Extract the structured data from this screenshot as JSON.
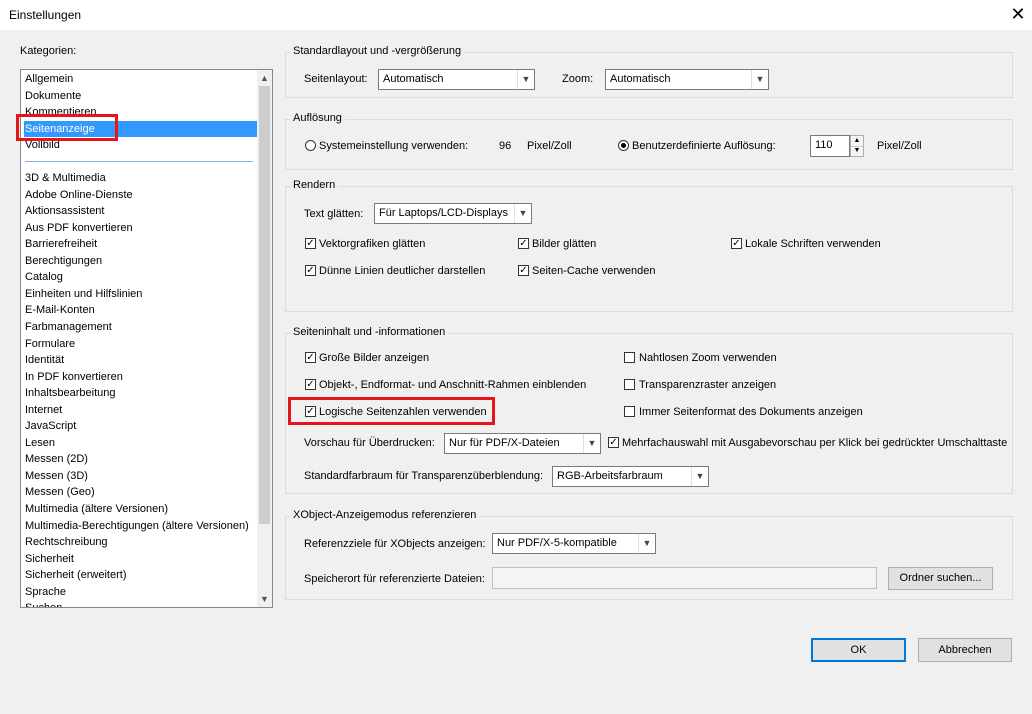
{
  "window": {
    "title": "Einstellungen"
  },
  "categories": {
    "label": "Kategorien:",
    "top_items": [
      "Allgemein",
      "Dokumente",
      "Kommentieren",
      "Seitenanzeige",
      "Vollbild"
    ],
    "items": [
      "3D & Multimedia",
      "Adobe Online-Dienste",
      "Aktionsassistent",
      "Aus PDF konvertieren",
      "Barrierefreiheit",
      "Berechtigungen",
      "Catalog",
      "Einheiten und Hilfslinien",
      "E-Mail-Konten",
      "Farbmanagement",
      "Formulare",
      "Identität",
      "In PDF konvertieren",
      "Inhaltsbearbeitung",
      "Internet",
      "JavaScript",
      "Lesen",
      "Messen (2D)",
      "Messen (3D)",
      "Messen (Geo)",
      "Multimedia (ältere Versionen)",
      "Multimedia-Berechtigungen (ältere Versionen)",
      "Rechtschreibung",
      "Sicherheit",
      "Sicherheit (erweitert)",
      "Sprache",
      "Suchen"
    ],
    "selected": "Seitenanzeige"
  },
  "layout": {
    "title": "Standardlayout und -vergrößerung",
    "page_layout_label": "Seitenlayout:",
    "page_layout_value": "Automatisch",
    "zoom_label": "Zoom:",
    "zoom_value": "Automatisch"
  },
  "resolution": {
    "title": "Auflösung",
    "system_label": "Systemeinstellung verwenden:",
    "system_value": "96",
    "unit1": "Pixel/Zoll",
    "custom_label": "Benutzerdefinierte Auflösung:",
    "custom_value": "110",
    "unit2": "Pixel/Zoll",
    "selected": "custom"
  },
  "render": {
    "title": "Rendern",
    "smooth_text_label": "Text glätten:",
    "smooth_text_value": "Für Laptops/LCD-Displays",
    "vector_label": "Vektorgrafiken glätten",
    "images_label": "Bilder glätten",
    "local_fonts_label": "Lokale Schriften verwenden",
    "thin_lines_label": "Dünne Linien deutlicher darstellen",
    "page_cache_label": "Seiten-Cache verwenden"
  },
  "content": {
    "title": "Seiteninhalt und -informationen",
    "large_images_label": "Große Bilder anzeigen",
    "seamless_zoom_label": "Nahtlosen Zoom verwenden",
    "art_trim_label": "Objekt-, Endformat- und Anschnitt-Rahmen einblenden",
    "transparency_grid_label": "Transparenzraster anzeigen",
    "logical_numbers_label": "Logische Seitenzahlen verwenden",
    "always_page_size_label": "Immer Seitenformat des Dokuments anzeigen",
    "overprint_label": "Vorschau für Überdrucken:",
    "overprint_value": "Nur für PDF/X-Dateien",
    "multi_select_label": "Mehrfachauswahl mit Ausgabevorschau per Klick bei gedrückter Umschalttaste",
    "blend_space_label": "Standardfarbraum für Transparenzüberblendung:",
    "blend_space_value": "RGB-Arbeitsfarbraum"
  },
  "xobject": {
    "title": "XObject-Anzeigemodus referenzieren",
    "targets_label": "Referenzziele für XObjects anzeigen:",
    "targets_value": "Nur PDF/X-5-kompatible",
    "location_label": "Speicherort für referenzierte Dateien:",
    "location_value": "",
    "browse_label": "Ordner suchen..."
  },
  "buttons": {
    "ok": "OK",
    "cancel": "Abbrechen"
  },
  "colors": {
    "highlight": "#e8141b",
    "selection": "#3399ff",
    "ok_border": "#0078d7"
  }
}
